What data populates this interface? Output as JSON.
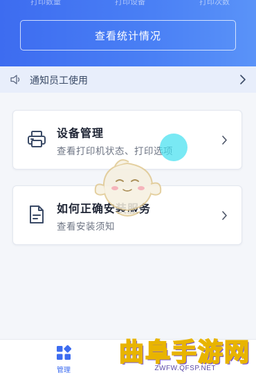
{
  "header": {
    "stat_labels": [
      "打印数量",
      "打印设备",
      "打印次数"
    ],
    "view_stats_label": "查看统计情况"
  },
  "notice": {
    "text": "通知员工使用"
  },
  "cards": [
    {
      "title": "设备管理",
      "subtitle": "查看打印机状态、打印选项"
    },
    {
      "title": "如何正确安装服务",
      "subtitle": "查看安装须知"
    }
  ],
  "bottom_nav": {
    "items": [
      {
        "label": "管理",
        "active": true
      }
    ]
  },
  "watermark": {
    "brand": "曲阜手游网",
    "url": "ZWFW.QFSP.NET"
  },
  "colors": {
    "accent": "#3d6cf0",
    "header_gradient_end": "#5a93f8",
    "notice_bg": "#e8eefb",
    "touch_indicator": "#40e0f0"
  }
}
